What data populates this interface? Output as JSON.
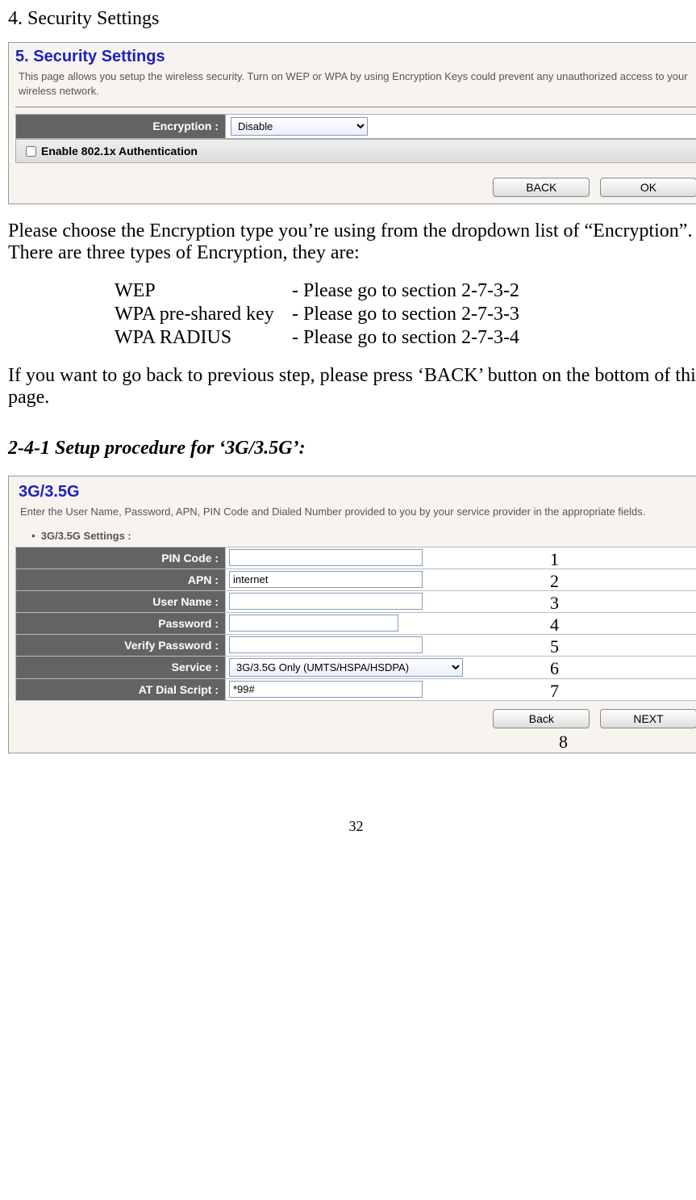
{
  "heading_1": "4. Security Settings",
  "panel1": {
    "title": "5. Security Settings",
    "desc": "This page allows you setup the wireless security. Turn on WEP or WPA by using Encryption Keys could prevent any unauthorized access to your wireless network.",
    "encryption_label": "Encryption :",
    "encryption_value": "Disable",
    "chk_label": "Enable 802.1x Authentication",
    "btn_back": "BACK",
    "btn_ok": "OK"
  },
  "para_intro": "Please choose the Encryption type you’re using from the dropdown list of “Encryption”. There are three types of Encryption, they are:",
  "enc": [
    {
      "name": "WEP",
      "ref": "- Please go to section 2-7-3-2"
    },
    {
      "name": "WPA pre-shared key",
      "ref": "- Please go to section 2-7-3-3"
    },
    {
      "name": "WPA RADIUS",
      "ref": "- Please go to section 2-7-3-4"
    }
  ],
  "para_back": "If you want to go back to previous step, please press ‘BACK’ button on the bottom of this page.",
  "subheading": "2-4-1 Setup procedure for ‘3G/3.5G’:",
  "panel2": {
    "title": "3G/3.5G",
    "desc": "Enter the User Name, Password, APN, PIN Code and Dialed Number provided to you by your service provider in the appropriate fields.",
    "settings_label": "3G/3.5G Settings :",
    "rows": [
      {
        "label": "PIN Code :",
        "value": "",
        "num": "1",
        "type": "text",
        "width": "230"
      },
      {
        "label": "APN :",
        "value": "internet",
        "num": "2",
        "type": "text",
        "width": "230"
      },
      {
        "label": "User Name :",
        "value": "",
        "num": "3",
        "type": "text",
        "width": "230"
      },
      {
        "label": "Password :",
        "value": "",
        "num": "4",
        "type": "password",
        "width": "200"
      },
      {
        "label": "Verify Password :",
        "value": "",
        "num": "5",
        "type": "password",
        "width": "230"
      },
      {
        "label": "Service :",
        "value": "3G/3.5G Only (UMTS/HSPA/HSDPA)",
        "num": "6",
        "type": "select",
        "width": "290"
      },
      {
        "label": "AT Dial Script :",
        "value": "*99#",
        "num": "7",
        "type": "text",
        "width": "230"
      }
    ],
    "btn_back": "Back",
    "btn_next": "NEXT",
    "overlay_8": "8"
  },
  "page_number": "32"
}
